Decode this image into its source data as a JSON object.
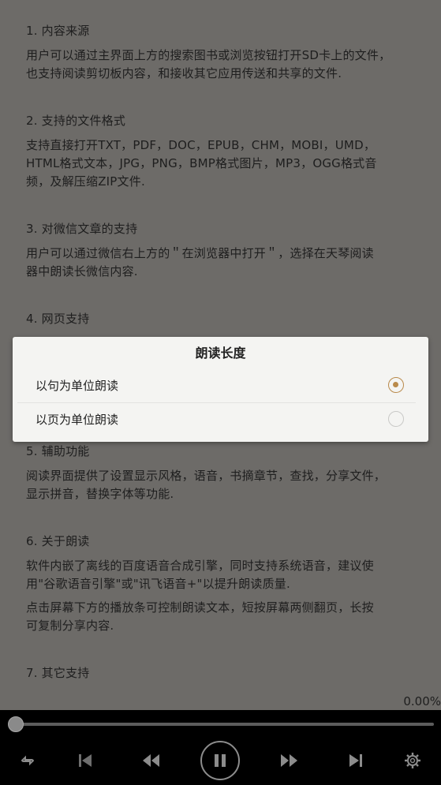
{
  "content": {
    "section1": {
      "heading": "1. 内容来源",
      "paras": [
        [
          "用户可以通过主界面上方的搜索图书或浏览按钮打开SD卡上的文件，",
          "也支持阅读剪切板内容，和接收其它应用传送和共享的文件."
        ]
      ]
    },
    "section2": {
      "heading": "2. 支持的文件格式",
      "paras": [
        [
          "支持直接打开TXT，PDF，DOC，EPUB，CHM，MOBI，UMD，",
          "HTML格式文本，JPG，PNG，BMP格式图片，MP3，OGG格式音",
          "频，及解压缩ZIP文件."
        ]
      ]
    },
    "section3": {
      "heading": "3. 对微信文章的支持",
      "paras": [
        [
          "用户可以通过微信右上方的＂在浏览器中打开＂，选择在天琴阅读",
          "器中朗读长微信内容."
        ]
      ]
    },
    "section4": {
      "heading": "4. 网页支持"
    },
    "section5": {
      "heading": "5. 辅助功能",
      "paras": [
        [
          "阅读界面提供了设置显示风格，语音，书摘章节，查找，分享文件，",
          "显示拼音，替换字体等功能."
        ]
      ]
    },
    "section6": {
      "heading": "6. 关于朗读",
      "paras": [
        [
          "软件内嵌了离线的百度语音合成引擎，同时支持系统语音，建议使",
          "用\"谷歌语音引擎\"或\"讯飞语音+\"以提升朗读质量."
        ],
        [
          "点击屏幕下方的播放条可控制朗读文本，短按屏幕两侧翻页，长按",
          "可复制分享内容."
        ]
      ]
    },
    "section7": {
      "heading": "7. 其它支持"
    }
  },
  "progress_text": "0.00%",
  "progress": 0.0,
  "dialog": {
    "title": "朗读长度",
    "options": [
      {
        "label": "以句为单位朗读",
        "selected": true
      },
      {
        "label": "以页为单位朗读",
        "selected": false
      }
    ]
  },
  "controls": {
    "icons": [
      "repeat-icon",
      "skip-previous-icon",
      "rewind-icon",
      "pause-icon",
      "fast-forward-icon",
      "skip-next-icon",
      "gear-icon"
    ]
  },
  "colors": {
    "accent": "#b98a4b",
    "overlay_bg": "#6d6b68",
    "dialog_bg": "#f4f4f2",
    "bar_bg": "#000000"
  }
}
